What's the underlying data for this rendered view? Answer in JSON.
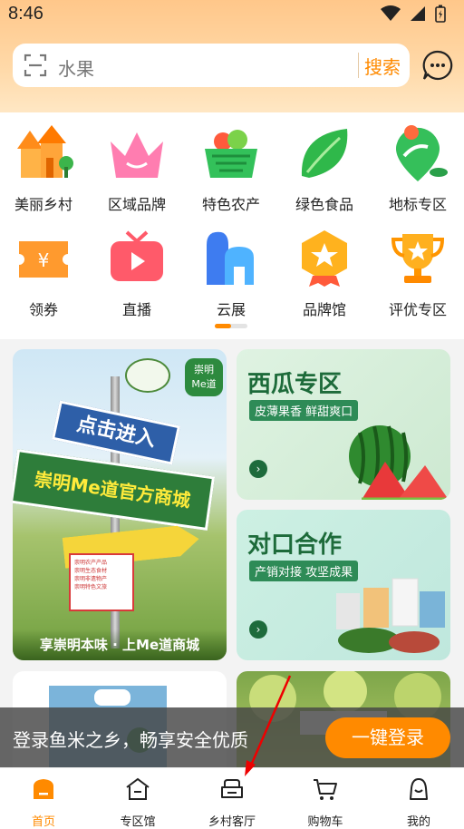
{
  "status_bar": {
    "time": "8:46"
  },
  "search": {
    "placeholder": "水果",
    "button_label": "搜索"
  },
  "categories": [
    {
      "label": "美丽乡村",
      "icon": "village-icon"
    },
    {
      "label": "区域品牌",
      "icon": "crown-icon"
    },
    {
      "label": "特色农产",
      "icon": "vegetable-basket-icon"
    },
    {
      "label": "绿色食品",
      "icon": "leaf-icon"
    },
    {
      "label": "地标专区",
      "icon": "location-pin-icon"
    },
    {
      "label": "领券",
      "icon": "coupon-icon"
    },
    {
      "label": "直播",
      "icon": "live-tv-icon"
    },
    {
      "label": "云展",
      "icon": "cloud-exhibition-icon"
    },
    {
      "label": "品牌馆",
      "icon": "brand-badge-icon"
    },
    {
      "label": "评优专区",
      "icon": "trophy-icon"
    }
  ],
  "banners": {
    "chongming": {
      "badge_text": "崇明\nMe道",
      "sign_top": "点击进入",
      "sign_main": "崇明Me道官方商城",
      "notice_lines": [
        "崇明农产产品",
        "崇明生态食材",
        "崇明非遗物产",
        "崇明特色文旅"
      ],
      "caption": "享崇明本味 · 上Me道商城"
    },
    "watermelon": {
      "title": "西瓜专区",
      "subtitle": "皮薄果香 鲜甜爽口"
    },
    "duikou": {
      "title": "对口合作",
      "subtitle": "产销对接 攻坚成果"
    }
  },
  "login_prompt": {
    "text": "登录鱼米之乡，畅享安全优质",
    "button_label": "一键登录"
  },
  "tabs": [
    {
      "label": "首页",
      "icon": "home-icon",
      "active": true
    },
    {
      "label": "专区馆",
      "icon": "pavilion-icon",
      "active": false
    },
    {
      "label": "乡村客厅",
      "icon": "sofa-icon",
      "active": false
    },
    {
      "label": "购物车",
      "icon": "cart-icon",
      "active": false
    },
    {
      "label": "我的",
      "icon": "profile-icon",
      "active": false
    }
  ],
  "colors": {
    "accent": "#ff8a00",
    "header_bg": "#ffc78a",
    "green": "#2e8b57"
  },
  "carousel": {
    "current_page": 1,
    "total_pages": 2
  }
}
